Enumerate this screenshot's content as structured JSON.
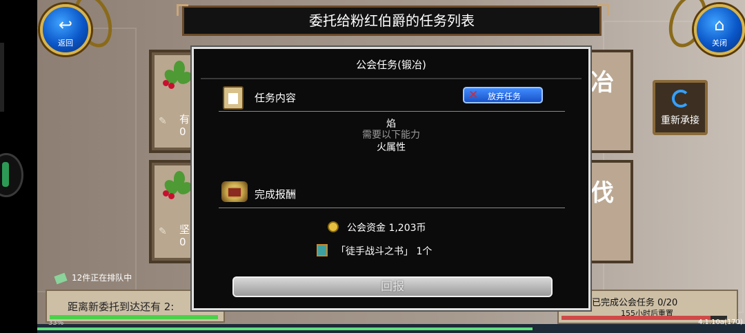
{
  "header": {
    "title": "委托给粉红伯爵的任务列表",
    "back_label": "返回",
    "close_label": "关闭"
  },
  "cards": [
    {
      "text_line1": "有",
      "text_line2": "0",
      "side_title": "冶"
    },
    {
      "text_line1": "坚",
      "text_line2": "0",
      "side_title": "伐"
    }
  ],
  "reaccept": {
    "label": "重新承接"
  },
  "queue": {
    "text": "12件正在排队中"
  },
  "bottom": {
    "left_text": "距离新委托到达还有 2:",
    "left_pct": "33%",
    "right_text1": "已完成公会任务  0/20",
    "right_text2": "155小时后重置",
    "version": "4.1.10a(170)"
  },
  "dialog": {
    "title": "公会任务(锻冶)",
    "section_content": "任务内容",
    "abandon_label": "放弃任务",
    "task_name": "焰",
    "requirement_label": "需要以下能力",
    "requirement_value": "火属性",
    "section_reward": "完成报酬",
    "rewards": [
      {
        "text": "公会资金  1,203币",
        "icon": "coins-icon"
      },
      {
        "text": "「徒手战斗之书」  1个",
        "icon": "book-icon"
      }
    ],
    "report_label": "回报"
  },
  "colors": {
    "accent_blue": "#1a52c8",
    "gold_border": "#d9b44a",
    "dialog_bg": "#0b0b0b"
  }
}
